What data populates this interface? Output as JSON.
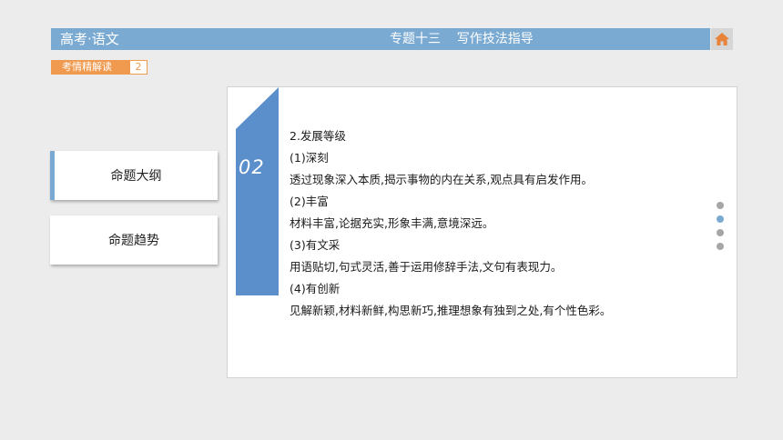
{
  "header": {
    "left_title": "高考·语文",
    "center_title": "专题十三    写作技法指导"
  },
  "section_tag": {
    "label": "考情精解读",
    "page": "2"
  },
  "nav": {
    "items": [
      {
        "label": "命题大纲",
        "active": true
      },
      {
        "label": "命题趋势",
        "active": false
      }
    ]
  },
  "ribbon": {
    "number": "02"
  },
  "content": {
    "lines": [
      "2.发展等级",
      "(1)深刻",
      "透过现象深入本质,揭示事物的内在关系,观点具有启发作用。",
      "(2)丰富",
      "材料丰富,论据充实,形象丰满,意境深远。",
      "(3)有文采",
      "用语贴切,句式灵活,善于运用修辞手法,文句有表现力。",
      "(4)有创新",
      "见解新颖,材料新鲜,构思新巧,推理想象有独到之处,有个性色彩。"
    ]
  },
  "pager": {
    "count": 4,
    "active_index": 1
  },
  "colors": {
    "header_blue": "#7aaad2",
    "ribbon_blue": "#5b8fcc",
    "tag_orange": "#ef9a4e",
    "home_orange": "#e8833a"
  },
  "icons": {
    "home": "home-icon"
  }
}
